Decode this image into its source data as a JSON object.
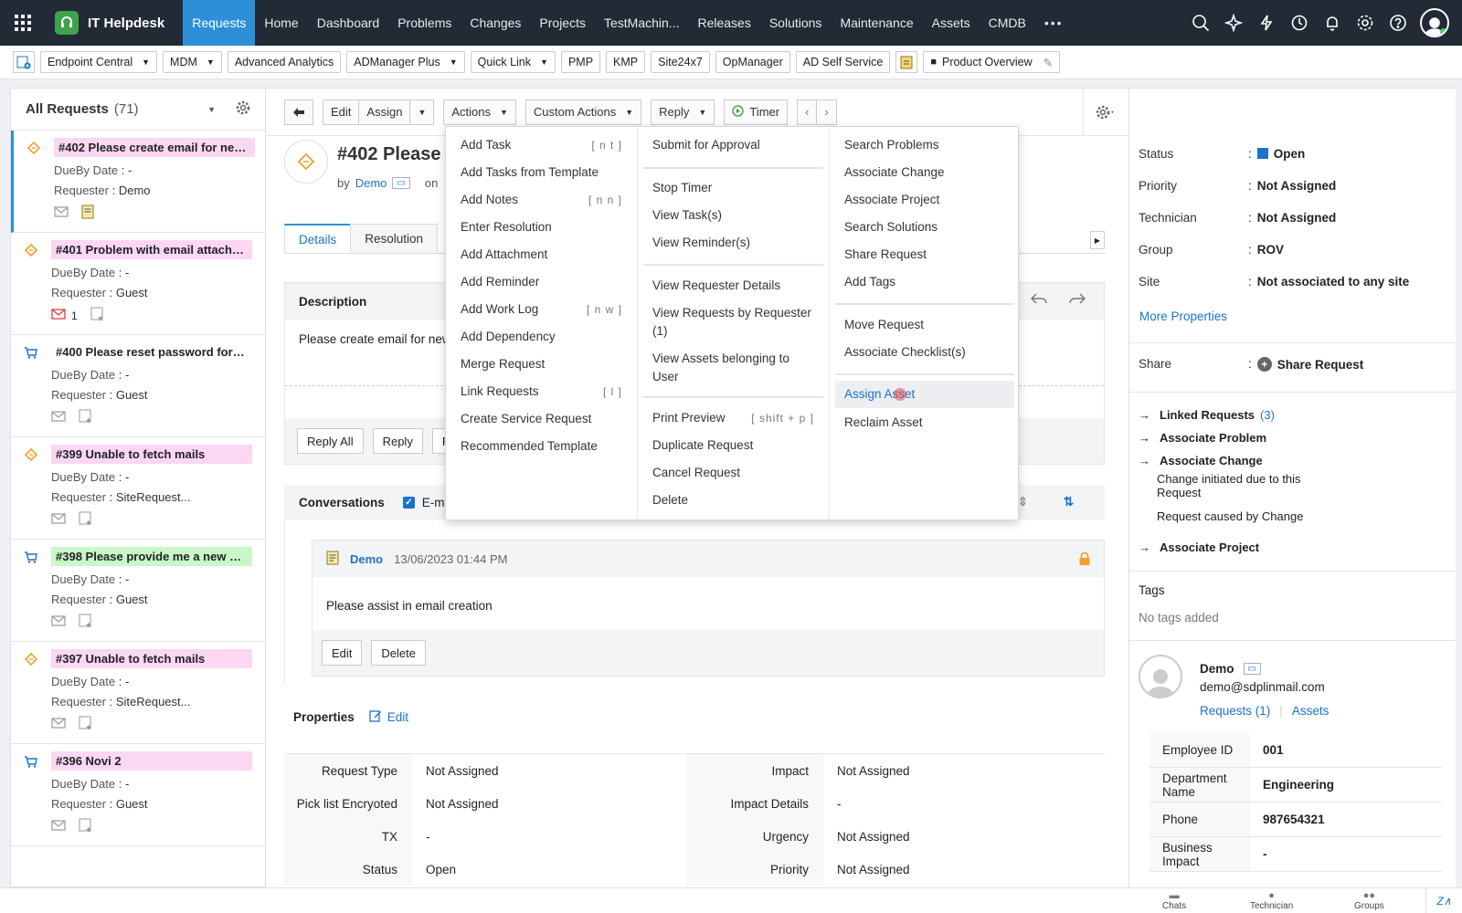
{
  "app": {
    "name": "IT Helpdesk"
  },
  "nav": [
    "Requests",
    "Home",
    "Dashboard",
    "Problems",
    "Changes",
    "Projects",
    "TestMachin...",
    "Releases",
    "Solutions",
    "Maintenance",
    "Assets",
    "CMDB"
  ],
  "quick": {
    "items": [
      "Endpoint Central",
      "MDM",
      "Advanced Analytics",
      "ADManager Plus",
      "Quick Link",
      "PMP",
      "KMP",
      "Site24x7",
      "OpManager",
      "AD Self Service"
    ],
    "product_overview": "Product Overview"
  },
  "list": {
    "title": "All Requests",
    "count": "(71)",
    "dueby_label": "DueBy Date",
    "requester_label": "Requester",
    "items": [
      {
        "title": "#402 Please create email for new e...",
        "dueby": ": -",
        "requester": ": Demo",
        "type": "incident",
        "color": "pink",
        "reply_count": ""
      },
      {
        "title": "#401 Problem with email attachme...",
        "dueby": ": -",
        "requester": ": Guest",
        "type": "incident",
        "color": "pink",
        "reply_count": "1"
      },
      {
        "title": "#400 Please reset password for my...",
        "dueby": ": -",
        "requester": ": Guest",
        "type": "service",
        "color": "none",
        "reply_count": ""
      },
      {
        "title": "#399 Unable to fetch mails",
        "dueby": ": -",
        "requester": ": SiteRequest...",
        "type": "incident",
        "color": "pink",
        "reply_count": ""
      },
      {
        "title": "#398 Please provide me a new des...",
        "dueby": ": -",
        "requester": ": Guest",
        "type": "service",
        "color": "green",
        "reply_count": ""
      },
      {
        "title": "#397 Unable to fetch mails",
        "dueby": ": -",
        "requester": ": SiteRequest...",
        "type": "incident",
        "color": "pink",
        "reply_count": ""
      },
      {
        "title": "#396 Novi 2",
        "dueby": ": -",
        "requester": ": Guest",
        "type": "service",
        "color": "pink",
        "reply_count": ""
      }
    ]
  },
  "toolbar": {
    "edit": "Edit",
    "assign": "Assign",
    "actions": "Actions",
    "custom_actions": "Custom Actions",
    "reply": "Reply",
    "timer": "Timer"
  },
  "request": {
    "title": "#402  Please c",
    "by_label": "by",
    "by": "Demo",
    "on_label": "on"
  },
  "tabs": [
    "Details",
    "Resolution"
  ],
  "description": {
    "label": "Description",
    "text": "Please create email for new",
    "reply_all": "Reply All",
    "reply": "Reply",
    "f": "F"
  },
  "conversations": {
    "label": "Conversations",
    "email_label": "E-mai"
  },
  "note": {
    "author": "Demo",
    "time": "13/06/2023 01:44 PM",
    "text": "Please assist in email creation",
    "edit": "Edit",
    "delete": "Delete"
  },
  "properties": {
    "label": "Properties",
    "edit": "Edit",
    "rows": [
      {
        "k1": "Request Type",
        "v1": "Not Assigned",
        "k2": "Impact",
        "v2": "Not Assigned"
      },
      {
        "k1": "Pick list Encryoted",
        "v1": "Not Assigned",
        "k2": "Impact Details",
        "v2": "-"
      },
      {
        "k1": "TX",
        "v1": "-",
        "k2": "Urgency",
        "v2": "Not Assigned"
      },
      {
        "k1": "Status",
        "v1": "Open",
        "k2": "Priority",
        "v2": "Not Assigned"
      }
    ]
  },
  "right": {
    "status_label": "Status",
    "status": "Open",
    "priority_label": "Priority",
    "priority": "Not Assigned",
    "technician_label": "Technician",
    "technician": "Not Assigned",
    "group_label": "Group",
    "group": "ROV",
    "site_label": "Site",
    "site": "Not associated to any site",
    "more": "More Properties",
    "share_label": "Share",
    "share": "Share Request",
    "linked": "Linked Requests",
    "linked_count": "(3)",
    "assoc_problem": "Associate Problem",
    "assoc_change": "Associate Change",
    "change_initiated": "Change initiated due to this Request",
    "caused_by": "Request caused by Change",
    "assoc_project": "Associate Project",
    "tags_label": "Tags",
    "no_tags": "No tags added",
    "user_name": "Demo",
    "user_email": "demo@sdplinmail.com",
    "user_requests": "Requests (1)",
    "user_assets": "Assets",
    "emp": [
      {
        "k": "Employee ID",
        "v": "001"
      },
      {
        "k": "Department Name",
        "v": "Engineering"
      },
      {
        "k": "Phone",
        "v": "987654321"
      },
      {
        "k": "Business Impact",
        "v": "-"
      }
    ]
  },
  "bottom": {
    "chats": "Chats",
    "technician": "Technician",
    "groups": "Groups"
  },
  "menu": {
    "col1": [
      {
        "label": "Add Task",
        "sc": "[ n t ]"
      },
      {
        "label": "Add Tasks from Template",
        "sc": ""
      },
      {
        "label": "Add Notes",
        "sc": "[ n n ]"
      },
      {
        "label": "Enter Resolution",
        "sc": ""
      },
      {
        "label": "Add Attachment",
        "sc": ""
      },
      {
        "label": "Add Reminder",
        "sc": ""
      },
      {
        "label": "Add Work Log",
        "sc": "[ n w ]"
      },
      {
        "label": "Add Dependency",
        "sc": ""
      },
      {
        "label": "Merge Request",
        "sc": ""
      },
      {
        "label": "Link Requests",
        "sc": "[ l ]"
      },
      {
        "label": "Create Service Request",
        "sc": ""
      },
      {
        "label": "Recommended Template",
        "sc": ""
      }
    ],
    "col2": {
      "submit": "Submit for Approval",
      "stop_timer": "Stop Timer",
      "view_tasks": "View Task(s)",
      "view_reminders": "View Reminder(s)",
      "view_req_details": "View Requester Details",
      "view_by_requester": "View Requests by Requester (1)",
      "view_assets": "View Assets belonging to User",
      "print": "Print Preview",
      "print_sc": "[ shift + p ]",
      "duplicate": "Duplicate Request",
      "cancel": "Cancel Request",
      "delete": "Delete"
    },
    "col3": {
      "search_problems": "Search Problems",
      "assoc_change": "Associate Change",
      "assoc_project": "Associate Project",
      "search_solutions": "Search Solutions",
      "share": "Share Request",
      "add_tags": "Add Tags",
      "move": "Move Request",
      "assoc_checklist": "Associate Checklist(s)",
      "assign_asset": "Assign Asset",
      "reclaim_asset": "Reclaim Asset"
    }
  },
  "colors": {
    "topbar": "#222a35",
    "accent": "#2c8fd8",
    "pink": "#fbd7f4",
    "green": "#c9f7c9"
  }
}
